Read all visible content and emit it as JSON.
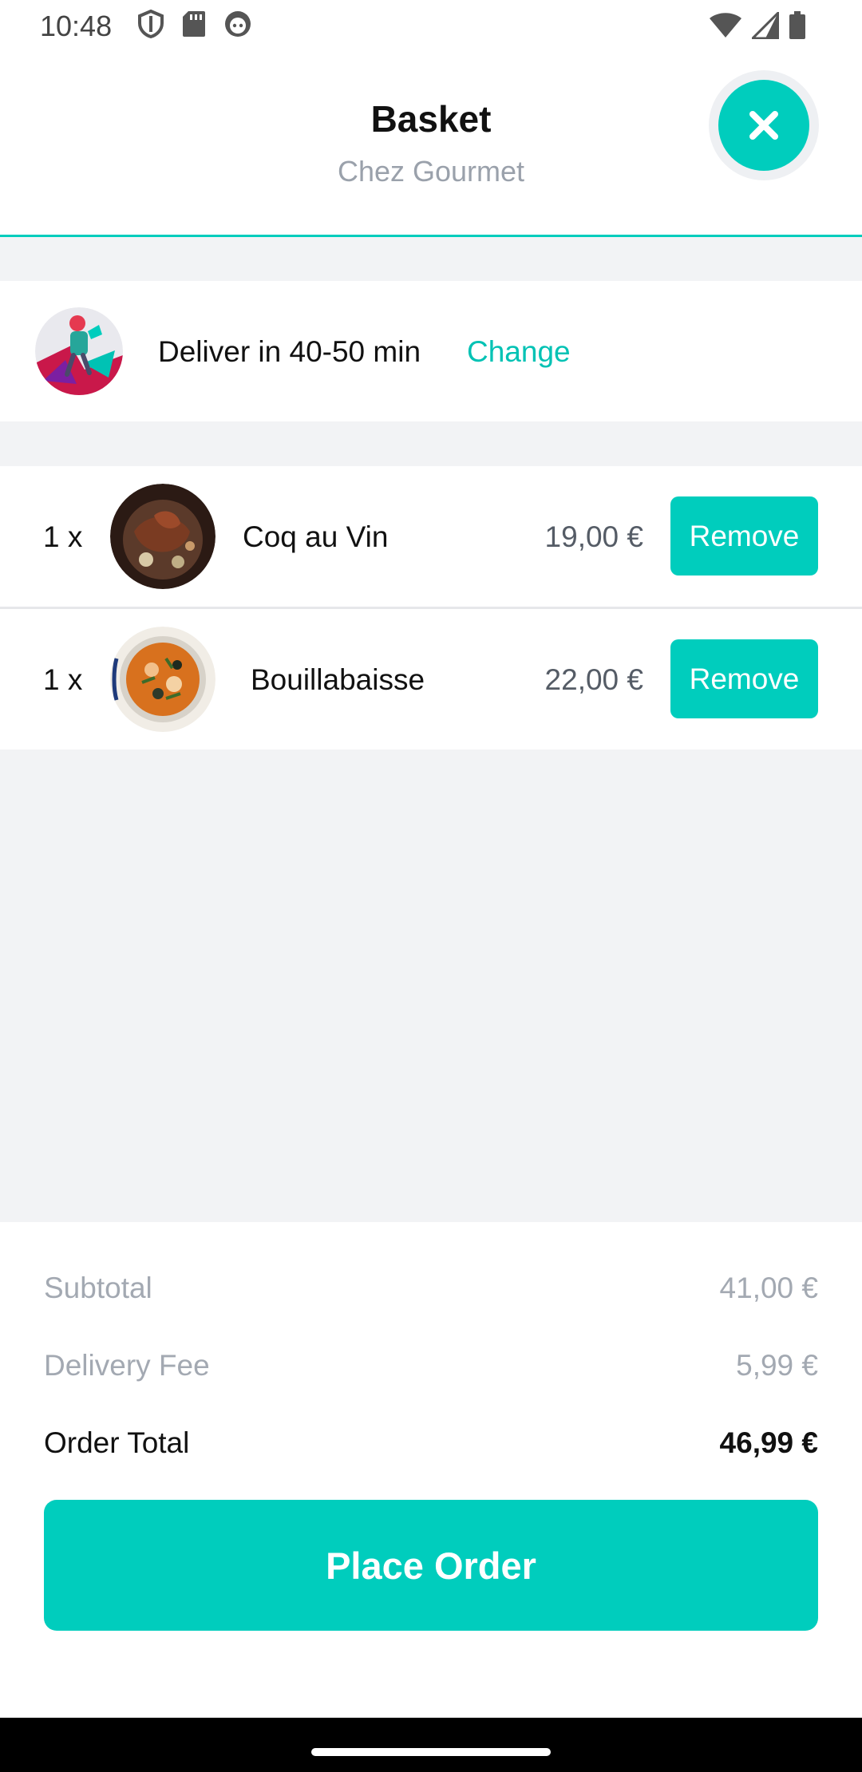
{
  "status_bar": {
    "time": "10:48",
    "left_icons": [
      "shield-icon",
      "sd-card-icon",
      "android-face-icon"
    ],
    "right_icons": [
      "wifi-icon",
      "cell-signal-icon",
      "battery-icon"
    ]
  },
  "header": {
    "title": "Basket",
    "subtitle": "Chez Gourmet",
    "close_icon": "close-icon"
  },
  "delivery": {
    "text": "Deliver in 40-50 min",
    "change_label": "Change",
    "avatar_icon": "delivery-rider-icon"
  },
  "basket": {
    "items": [
      {
        "qty": "1 x",
        "name": "Coq au Vin",
        "price": "19,00 €",
        "remove_label": "Remove"
      },
      {
        "qty": "1 x",
        "name": "Bouillabaisse",
        "price": "22,00 €",
        "remove_label": "Remove"
      }
    ]
  },
  "summary": {
    "subtotal_label": "Subtotal",
    "subtotal_value": "41,00 €",
    "delivery_fee_label": "Delivery Fee",
    "delivery_fee_value": "5,99 €",
    "total_label": "Order Total",
    "total_value": "46,99 €",
    "place_order_label": "Place Order"
  },
  "colors": {
    "accent": "#00cdbd",
    "muted_text": "#a3a9b2",
    "page_background": "#f2f3f5"
  }
}
